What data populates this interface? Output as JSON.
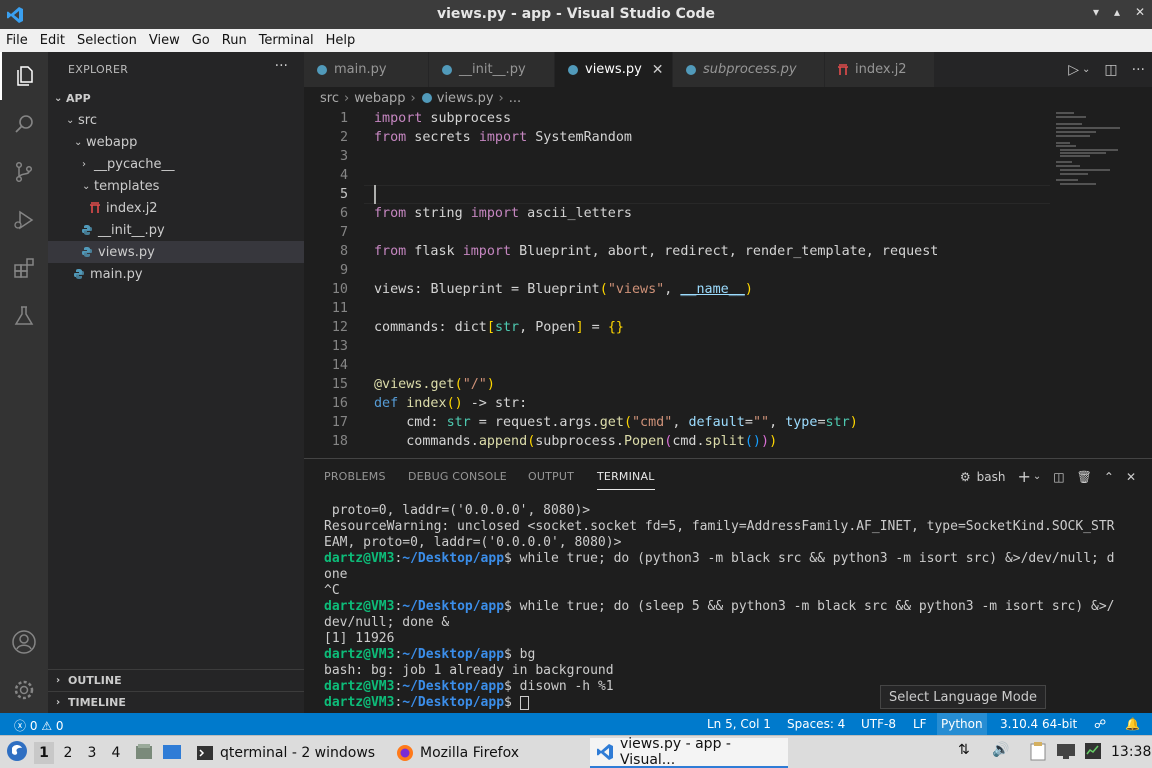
{
  "window": {
    "title": "views.py - app - Visual Studio Code"
  },
  "menu": [
    "File",
    "Edit",
    "Selection",
    "View",
    "Go",
    "Run",
    "Terminal",
    "Help"
  ],
  "sidebar": {
    "header": "EXPLORER",
    "root": "APP",
    "tree": [
      {
        "label": "src",
        "type": "folder"
      },
      {
        "label": "webapp",
        "type": "folder"
      },
      {
        "label": "__pycache__",
        "type": "folder-collapsed"
      },
      {
        "label": "templates",
        "type": "folder"
      },
      {
        "label": "index.j2",
        "type": "jinja"
      },
      {
        "label": "__init__.py",
        "type": "python"
      },
      {
        "label": "views.py",
        "type": "python",
        "selected": true
      },
      {
        "label": "main.py",
        "type": "python"
      }
    ],
    "outline": "OUTLINE",
    "timeline": "TIMELINE"
  },
  "tabs": [
    {
      "label": "main.py",
      "icon": "python"
    },
    {
      "label": "__init__.py",
      "icon": "python"
    },
    {
      "label": "views.py",
      "icon": "python",
      "active": true
    },
    {
      "label": "subprocess.py",
      "icon": "python",
      "italic": true
    },
    {
      "label": "index.j2",
      "icon": "jinja"
    }
  ],
  "breadcrumb": [
    "src",
    "webapp",
    "views.py",
    "..."
  ],
  "editor": {
    "line_numbers": [
      "1",
      "2",
      "3",
      "4",
      "5",
      "6",
      "7",
      "8",
      "9",
      "10",
      "11",
      "12",
      "13",
      "14",
      "15",
      "16",
      "17",
      "18"
    ],
    "current_line": "5",
    "lines": {
      "l1": {
        "kw": "import",
        "rest": " subprocess"
      },
      "l2": {
        "kw1": "from",
        "mod": " secrets ",
        "kw2": "import",
        "rest": " SystemRandom"
      },
      "l6": {
        "kw1": "from",
        "mod": " string ",
        "kw2": "import",
        "rest": " ascii_letters"
      },
      "l8": {
        "kw1": "from",
        "mod": " flask ",
        "kw2": "import",
        "rest": " Blueprint, abort, redirect, render_template, request"
      },
      "l10": {
        "a": "views: ",
        "b": "Blueprint",
        "c": " = ",
        "d": "Blueprint",
        "e": "(",
        "f": "\"views\"",
        "g": ", ",
        "h": "__name__",
        "i": ")"
      },
      "l12": {
        "a": "commands: ",
        "b": "dict",
        "c": "[",
        "d": "str",
        "e": ", ",
        "f": "Popen",
        "g": "]",
        "h": " = ",
        "i": "{}"
      },
      "l15": {
        "a": "@views.",
        "b": "get",
        "c": "(",
        "d": "\"/\"",
        "e": ")"
      },
      "l16": {
        "a": "def",
        "b": " ",
        "c": "index",
        "d": "()",
        "e": " -> ",
        "f": "str",
        "g": ":"
      },
      "l17": {
        "a": "    cmd: ",
        "b": "str",
        "c": " = request.args.",
        "d": "get",
        "e": "(",
        "f": "\"cmd\"",
        "g": ", ",
        "h": "default",
        "i": "=",
        "j": "\"\"",
        "k": ", ",
        "l": "type",
        "m": "=",
        "n": "str",
        "o": ")"
      },
      "l18": {
        "a": "    commands.",
        "b": "append",
        "c": "(",
        "d": "subprocess.",
        "e": "Popen",
        "f": "(",
        "g": "cmd.",
        "h": "split",
        "i": "()",
        "j": ")",
        "k": ")"
      }
    }
  },
  "panel": {
    "tabs": [
      "PROBLEMS",
      "DEBUG CONSOLE",
      "OUTPUT",
      "TERMINAL"
    ],
    "active_tab": "TERMINAL",
    "shell": "bash",
    "terminal": {
      "t1": " proto=0, laddr=('0.0.0.0', 8080)>",
      "t2": "ResourceWarning: unclosed <socket.socket fd=5, family=AddressFamily.AF_INET, type=SocketKind.SOCK_STR",
      "t3": "EAM, proto=0, laddr=('0.0.0.0', 8080)>",
      "user": "dartz@VM3",
      "path": "~/Desktop/app",
      "c1": "$ while true; do (python3 -m black src && python3 -m isort src) &>/dev/null; d",
      "t5": "one",
      "t6": "^C",
      "c2": "$ while true; do (sleep 5 && python3 -m black src && python3 -m isort src) &>/",
      "t8": "dev/null; done &",
      "t9": "[1] 11926",
      "c3": "$ bg",
      "t11": "bash: bg: job 1 already in background",
      "c4": "$ disown -h %1",
      "c5": "$ "
    }
  },
  "tooltip": "Select Language Mode",
  "status": {
    "errors": "0",
    "warnings": "0",
    "position": "Ln 5, Col 1",
    "spaces": "Spaces: 4",
    "encoding": "UTF-8",
    "eol": "LF",
    "language": "Python",
    "interpreter": "3.10.4 64-bit"
  },
  "taskbar": {
    "workspaces": [
      "1",
      "2",
      "3",
      "4"
    ],
    "tasks": [
      "qterminal - 2 windows",
      "Mozilla Firefox",
      "views.py - app - Visual..."
    ],
    "clock": "13:38"
  },
  "colors": {
    "accent": "#007acc",
    "titlebar": "#3c3c3c",
    "editor_bg": "#1e1e1e",
    "sidebar_bg": "#252526"
  }
}
